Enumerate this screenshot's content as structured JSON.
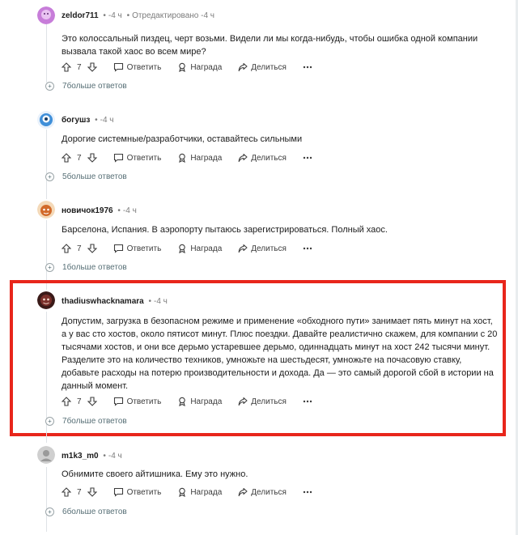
{
  "labels": {
    "reply": "Ответить",
    "award": "Награда",
    "share": "Делиться",
    "more_suffix": "больше ответов"
  },
  "comments": [
    {
      "author": "zeldor711",
      "time": "-4 ч",
      "edited": "Отредактировано -4 ч",
      "text": "Это колоссальный пиздец, черт возьми. Видели ли мы когда-нибудь, чтобы ошибка одной компании вызвала такой хаос во всем мире?",
      "votes": "7",
      "more_count": "7",
      "avatar_color": "#c77dd9"
    },
    {
      "author": "богушз",
      "time": "-4 ч",
      "text": "Дорогие системные/разработчики, оставайтесь сильными",
      "votes": "7",
      "more_count": "5",
      "avatar_color": "#3f8fd9"
    },
    {
      "author": "новичок1976",
      "time": "-4 ч",
      "text": "Барселона, Испания. В аэропорту пытаюсь зарегистрироваться. Полный хаос.",
      "votes": "7",
      "more_count": "1",
      "avatar_color": "#d26a2a"
    },
    {
      "author": "thadiuswhacknamara",
      "time": "-4 ч",
      "text": "Допустим, загрузка в безопасном режиме и применение «обходного пути» занимает пять минут на хост, а у вас сто хостов, около пятисот минут. Плюс поездки. Давайте реалистично скажем, для компании с 20 тысячами хостов, и они все дерьмо устаревшее дерьмо, одиннадцать минут на хост 242 тысячи минут. Разделите это на количество техников, умножьте на шестьдесят, умножьте на почасовую ставку, добавьте расходы на потерю производительности и дохода. Да — это самый дорогой сбой в истории на данный момент.",
      "votes": "7",
      "more_count": "7",
      "avatar_color": "#7a2f2a"
    },
    {
      "author": "m1k3_m0",
      "time": "-4 ч",
      "text": "Обнимите своего айтишника. Ему это нужно.",
      "votes": "7",
      "more_count": "6",
      "avatar_color": "#9a9a9a"
    }
  ],
  "highlight_color": "#e8261b"
}
